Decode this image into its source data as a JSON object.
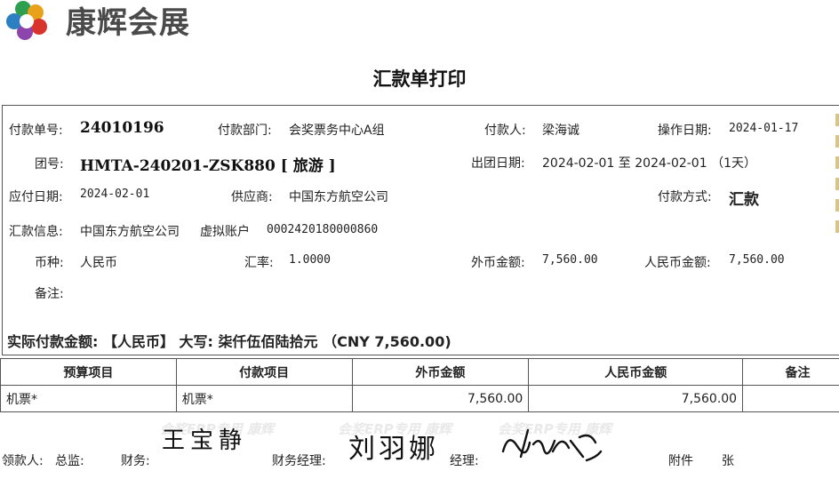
{
  "header": {
    "brand": "康辉会展",
    "title": "汇款单打印"
  },
  "fields": {
    "pay_no_label": "付款单号:",
    "pay_no": "24010196",
    "dept_label": "付款部门:",
    "dept": "会奖票务中心A组",
    "payer_label": "付款人:",
    "payer": "梁海诚",
    "op_date_label": "操作日期:",
    "op_date": "2024-01-17",
    "group_label": "团号:",
    "group": "HMTA-240201-ZSK880 [ 旅游 ]",
    "depart_label": "出团日期:",
    "depart": "2024-02-01 至 2024-02-01 （1天）",
    "due_label": "应付日期:",
    "due": "2024-02-01",
    "supplier_label": "供应商:",
    "supplier": "中国东方航空公司",
    "method_label": "付款方式:",
    "method": "汇款",
    "remit_label": "汇款信息:",
    "remit_name": "中国东方航空公司",
    "remit_acct_type": "虚拟账户",
    "remit_acct": "0002420180000860",
    "currency_label": "币种:",
    "currency": "人民币",
    "rate_label": "汇率:",
    "rate": "1.0000",
    "fx_amount_label": "外币金额:",
    "fx_amount": "7,560.00",
    "rmb_amount_label": "人民币金额:",
    "rmb_amount": "7,560.00",
    "note_label": "备注:",
    "actual": "实际付款金额: 【人民币】 大写: 柒仟伍佰陆拾元 （CNY 7,560.00)"
  },
  "table": {
    "headers": [
      "预算项目",
      "付款项目",
      "外币金额",
      "人民币金额",
      "备注"
    ],
    "rows": [
      [
        "机票*",
        "机票*",
        "7,560.00",
        "7,560.00",
        ""
      ]
    ]
  },
  "footer": {
    "payee": "领款人:",
    "director": "总监:",
    "finance": "财务:",
    "finance_mgr": "财务经理:",
    "manager": "经理:",
    "attach": "附件",
    "sheets": "张",
    "watermark": "会奖ERP专用 康辉",
    "signature1": "王宝静",
    "signature2": "刘羽娜"
  }
}
